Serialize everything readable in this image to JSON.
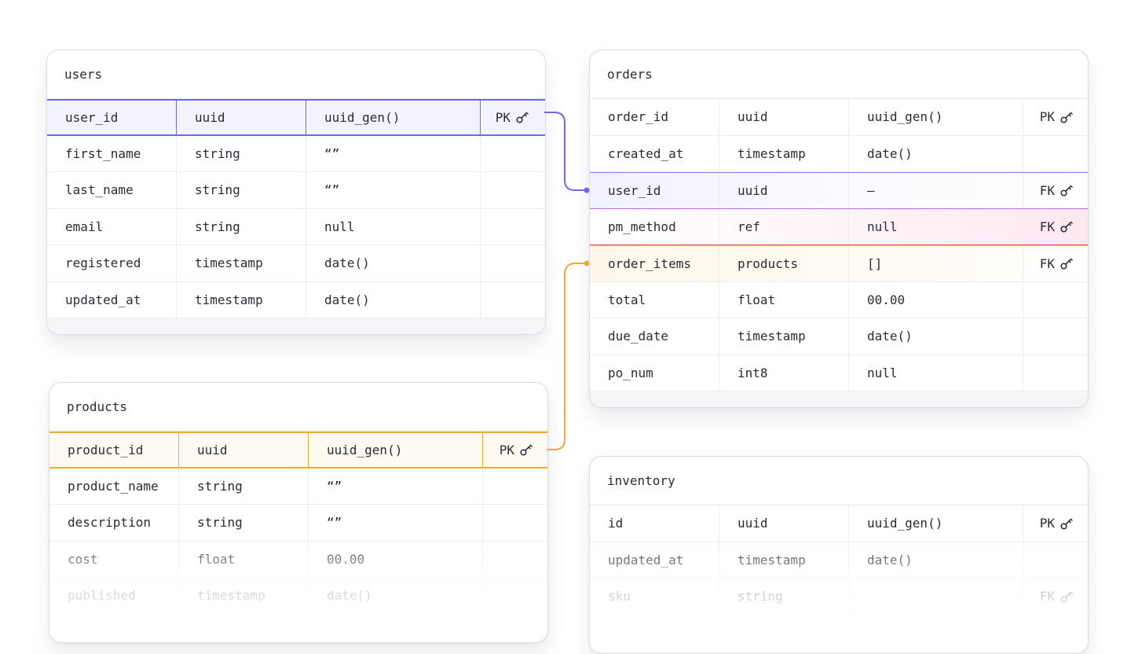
{
  "tables": {
    "users": {
      "title": "users",
      "rows": [
        [
          "user_id",
          "uuid",
          "uuid_gen()",
          "PK"
        ],
        [
          "first_name",
          "string",
          "“”",
          ""
        ],
        [
          "last_name",
          "string",
          "“”",
          ""
        ],
        [
          "email",
          "string",
          "null",
          ""
        ],
        [
          "registered",
          "timestamp",
          "date()",
          ""
        ],
        [
          "updated_at",
          "timestamp",
          "date()",
          ""
        ]
      ]
    },
    "orders": {
      "title": "orders",
      "rows": [
        [
          "order_id",
          "uuid",
          "uuid_gen()",
          "PK"
        ],
        [
          "created_at",
          "timestamp",
          "date()",
          ""
        ],
        [
          "user_id",
          "uuid",
          "–",
          "FK"
        ],
        [
          "pm_method",
          "ref",
          "null",
          "FK"
        ],
        [
          "order_items",
          "products",
          "[]",
          "FK"
        ],
        [
          "total",
          "float",
          "00.00",
          ""
        ],
        [
          "due_date",
          "timestamp",
          "date()",
          ""
        ],
        [
          "po_num",
          "int8",
          "null",
          ""
        ]
      ]
    },
    "products": {
      "title": "products",
      "rows": [
        [
          "product_id",
          "uuid",
          "uuid_gen()",
          "PK"
        ],
        [
          "product_name",
          "string",
          "“”",
          ""
        ],
        [
          "description",
          "string",
          "“”",
          ""
        ],
        [
          "cost",
          "float",
          "00.00",
          ""
        ],
        [
          "published",
          "timestamp",
          "date()",
          ""
        ]
      ]
    },
    "inventory": {
      "title": "inventory",
      "rows": [
        [
          "id",
          "uuid",
          "uuid_gen()",
          "PK"
        ],
        [
          "updated_at",
          "timestamp",
          "date()",
          ""
        ],
        [
          "sku",
          "string",
          "",
          "FK"
        ]
      ]
    }
  },
  "colors": {
    "purple": "#7367e8",
    "pink": "#e0558f",
    "orange": "#f1a93a",
    "text": "#2b2b36"
  },
  "icons": {
    "key": "key-icon"
  }
}
